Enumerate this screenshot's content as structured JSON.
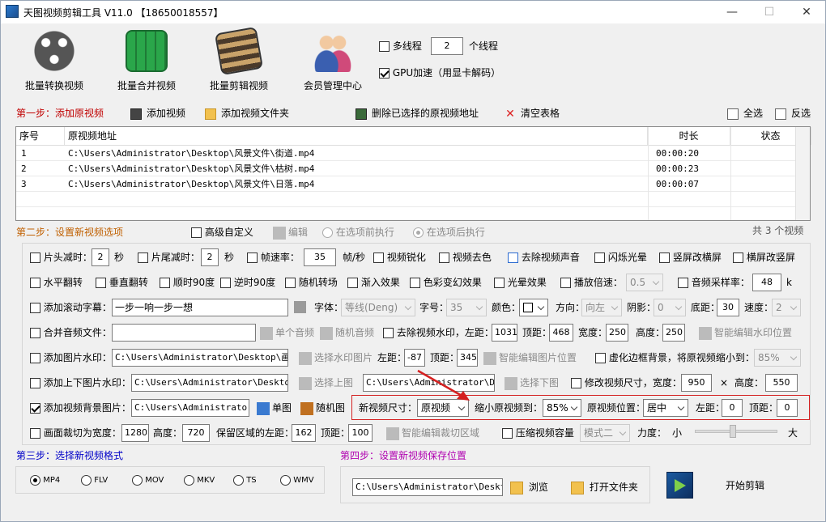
{
  "window": {
    "title": "天图视频剪辑工具 V11.0  【18650018557】",
    "minimize": "—",
    "maximize": "☐",
    "close": "✕"
  },
  "toolbar": {
    "batch_convert": "批量转换视频",
    "batch_merge": "批量合并视频",
    "batch_cut": "批量剪辑视频",
    "member_center": "会员管理中心",
    "multithread_label": "多线程",
    "threads_value": "2",
    "threads_unit": "个线程",
    "gpu_label": "GPU加速（用显卡解码）"
  },
  "step1": {
    "label": "第一步：添加原视频",
    "add_video": "添加视频",
    "add_folder": "添加视频文件夹",
    "delete_selected": "删除已选择的原视频地址",
    "clear_table": "清空表格",
    "select_all": "全选",
    "invert": "反选"
  },
  "table": {
    "headers": {
      "index": "序号",
      "path": "原视频地址",
      "duration": "时长",
      "status": "状态"
    },
    "rows": [
      {
        "index": "1",
        "path": "C:\\Users\\Administrator\\Desktop\\风景文件\\街道.mp4",
        "duration": "00:00:20",
        "status": ""
      },
      {
        "index": "2",
        "path": "C:\\Users\\Administrator\\Desktop\\风景文件\\枯树.mp4",
        "duration": "00:00:23",
        "status": ""
      },
      {
        "index": "3",
        "path": "C:\\Users\\Administrator\\Desktop\\风景文件\\日落.mp4",
        "duration": "00:00:07",
        "status": ""
      }
    ],
    "count": "共 3 个视频"
  },
  "step2": {
    "label": "第二步：设置新视频选项",
    "advanced": "高级自定义",
    "edit": "编辑",
    "before": "在选项前执行",
    "after": "在选项后执行"
  },
  "opts": {
    "r1": {
      "head_cut": "片头减时：",
      "head_val": "2",
      "sec1": "秒",
      "tail_cut": "片尾减时：",
      "tail_val": "2",
      "sec2": "秒",
      "fps": "帧速率：",
      "fps_val": "35",
      "fps_unit": "帧/秒",
      "sharpen": "视频锐化",
      "decolor": "视频去色",
      "remove_audio": "去除视频声音",
      "flash": "闪烁光晕",
      "v2h": "竖屏改横屏",
      "h2v": "横屏改竖屏"
    },
    "r2": {
      "hflip": "水平翻转",
      "vflip": "垂直翻转",
      "rot90": "顺时90度",
      "rot90ccw": "逆时90度",
      "random_trans": "随机转场",
      "fade_in": "渐入效果",
      "color_fx": "色彩变幻效果",
      "light_fx": "光晕效果",
      "speed": "播放倍速：",
      "speed_val": "0.5",
      "sample_rate": "音频采样率：",
      "sample_val": "48",
      "k": "k"
    },
    "r3": {
      "scroll_sub": "添加滚动字幕：",
      "sub_text": "一步一响一步一想",
      "font": "字体：",
      "font_val": "等线(Deng)",
      "size": "字号：",
      "size_val": "35",
      "color": "颜色：",
      "dir": "方向：",
      "dir_val": "向左",
      "shadow": "阴影：",
      "shadow_val": "0",
      "bottom": "底距：",
      "bottom_val": "30",
      "spd": "速度：",
      "spd_val": "2"
    },
    "r4": {
      "merge_audio": "合并音频文件：",
      "single_audio": "单个音频",
      "random_audio": "随机音频",
      "remove_wm": "去除视频水印，左距：",
      "left_val": "1031",
      "top": "顶距：",
      "top_val": "468",
      "width": "宽度：",
      "width_val": "250",
      "height": "高度：",
      "height_val": "250",
      "smart_wm": "智能编辑水印位置"
    },
    "r5": {
      "img_wm": "添加图片水印：",
      "img_path": "C:\\Users\\Administrator\\Desktop\\画中画",
      "choose_wm": "选择水印图片",
      "left": "左距：",
      "left_val": "-87",
      "top": "顶距：",
      "top_val": "345",
      "smart_img": "智能编辑图片位置",
      "blur_bg": "虚化边框背景，将原视频缩小到：",
      "blur_val": "85%"
    },
    "r6": {
      "tb_wm": "添加上下图片水印：",
      "top_path": "C:\\Users\\Administrator\\Desktop\\A",
      "choose_top": "选择上图",
      "bottom_path": "C:\\Users\\Administrator\\Desk",
      "choose_bottom": "选择下图",
      "resize": "修改视频尺寸，宽度：",
      "w_val": "950",
      "times": "×",
      "h": "高度：",
      "h_val": "550"
    },
    "r7": {
      "bg_img": "添加视频背景图片：",
      "bg_path": "C:\\Users\\Administrator\\Desktop\\D",
      "single_img": "单图",
      "random_img": "随机图",
      "new_size": "新视频尺寸：",
      "new_size_val": "原视频",
      "shrink": "缩小原视频到：",
      "shrink_val": "85%",
      "pos": "原视频位置：",
      "pos_val": "居中",
      "left": "左距：",
      "left_val": "0",
      "top": "顶距：",
      "top_val": "0"
    },
    "r8": {
      "crop": "画面裁切为宽度：",
      "crop_w": "1280",
      "h": "高度：",
      "crop_h": "720",
      "keep_left": "保留区域的左距：",
      "keep_left_val": "162",
      "top": "顶距：",
      "top_val": "100",
      "smart_crop": "智能编辑裁切区域",
      "compress": "压缩视频容量",
      "mode": "模式二",
      "force": "力度：",
      "small": "小",
      "big": "大"
    }
  },
  "step3": {
    "label": "第三步：选择新视频格式",
    "formats": [
      "MP4",
      "FLV",
      "MOV",
      "MKV",
      "TS",
      "WMV"
    ]
  },
  "step4": {
    "label": "第四步：设置新视频保存位置",
    "path": "C:\\Users\\Administrator\\Desktop\\",
    "browse": "浏览",
    "open_folder": "打开文件夹",
    "start": "开始剪辑"
  },
  "colors": {
    "highlight": "#d42020",
    "step1": "#c00000",
    "step3": "#0000c8",
    "step4": "#b000b0"
  }
}
